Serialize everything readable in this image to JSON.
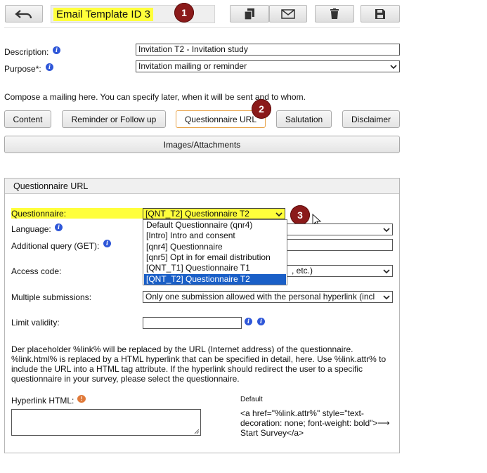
{
  "toolbar": {
    "back_icon": "back-arrow-icon",
    "title": "Email Template ID 3",
    "copy_icon": "copy-icon",
    "mail_icon": "envelope-icon",
    "delete_icon": "trash-icon",
    "save_icon": "floppy-disk-icon"
  },
  "badges": [
    "1",
    "2",
    "3"
  ],
  "form": {
    "description_label": "Description:",
    "description_value": "Invitation T2 -  Invitation study",
    "purpose_label": "Purpose*:",
    "purpose_value": "Invitation mailing or reminder",
    "compose_hint": "Compose a mailing here. You can specify later, when it will be sent and to whom."
  },
  "tabs": [
    {
      "label": "Content",
      "active": false
    },
    {
      "label": "Reminder or Follow up",
      "active": false
    },
    {
      "label": "Questionnaire URL",
      "active": true
    },
    {
      "label": "Salutation",
      "active": false
    },
    {
      "label": "Disclaimer",
      "active": false
    }
  ],
  "images_button": "Images/Attachments",
  "panel": {
    "title": "Questionnaire URL",
    "questionnaire_label": "Questionnaire:",
    "questionnaire_value": "[QNT_T2] Questionnaire T2",
    "language_label": "Language:",
    "additional_query_label": "Additional query (GET):",
    "access_code_label": "Access code:",
    "access_code_value_visible": ", etc.)",
    "multiple_submissions_label": "Multiple submissions:",
    "multiple_submissions_value": "Only one submission allowed with the personal hyperlink (incl",
    "limit_validity_label": "Limit validity:",
    "dropdown_options": [
      "Default Questionnaire (qnr4)",
      "[Intro] Intro and consent",
      "[qnr4] Questionnaire",
      "[qnr5] Opt in for email distribution",
      "[QNT_T1] Questionnaire T1",
      "[QNT_T2] Questionnaire T2"
    ],
    "selected_option": "[QNT_T2] Questionnaire T2",
    "description": "Der placeholder %link% will be replaced by the URL (Internet address) of the questionnaire. %link.html% is replaced by a HTML hyperlink that can be specified in detail, here. Use %link.attr% to include the URL into a HTML tag attribute. If the hyperlink should redirect the user to a specific questionnaire in your survey, please select the questionnaire.",
    "hyperlink_label": "Hyperlink HTML:",
    "default_label": "Default",
    "default_code": "<a href=\"%link.attr%\" style=\"text-decoration: none; font-weight: bold\">⟶ Start Survey</a>"
  },
  "colors": {
    "highlight": "#ffff3b",
    "badge": "#8b1a1a",
    "selected": "#1a5fc7",
    "active_tab_border": "#e8a34a"
  }
}
